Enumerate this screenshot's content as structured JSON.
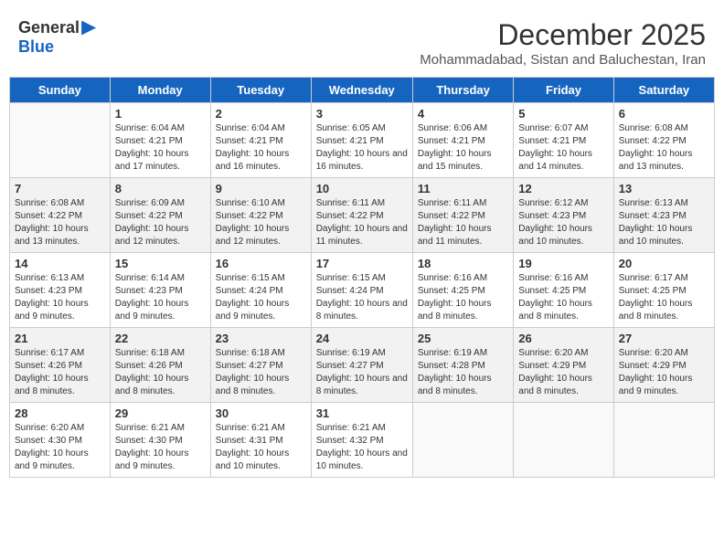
{
  "logo": {
    "general": "General",
    "blue": "Blue"
  },
  "title": "December 2025",
  "subtitle": "Mohammadabad, Sistan and Baluchestan, Iran",
  "days_of_week": [
    "Sunday",
    "Monday",
    "Tuesday",
    "Wednesday",
    "Thursday",
    "Friday",
    "Saturday"
  ],
  "weeks": [
    [
      {
        "day": "",
        "info": ""
      },
      {
        "day": "1",
        "info": "Sunrise: 6:04 AM\nSunset: 4:21 PM\nDaylight: 10 hours and 17 minutes."
      },
      {
        "day": "2",
        "info": "Sunrise: 6:04 AM\nSunset: 4:21 PM\nDaylight: 10 hours and 16 minutes."
      },
      {
        "day": "3",
        "info": "Sunrise: 6:05 AM\nSunset: 4:21 PM\nDaylight: 10 hours and 16 minutes."
      },
      {
        "day": "4",
        "info": "Sunrise: 6:06 AM\nSunset: 4:21 PM\nDaylight: 10 hours and 15 minutes."
      },
      {
        "day": "5",
        "info": "Sunrise: 6:07 AM\nSunset: 4:21 PM\nDaylight: 10 hours and 14 minutes."
      },
      {
        "day": "6",
        "info": "Sunrise: 6:08 AM\nSunset: 4:22 PM\nDaylight: 10 hours and 13 minutes."
      }
    ],
    [
      {
        "day": "7",
        "info": "Sunrise: 6:08 AM\nSunset: 4:22 PM\nDaylight: 10 hours and 13 minutes."
      },
      {
        "day": "8",
        "info": "Sunrise: 6:09 AM\nSunset: 4:22 PM\nDaylight: 10 hours and 12 minutes."
      },
      {
        "day": "9",
        "info": "Sunrise: 6:10 AM\nSunset: 4:22 PM\nDaylight: 10 hours and 12 minutes."
      },
      {
        "day": "10",
        "info": "Sunrise: 6:11 AM\nSunset: 4:22 PM\nDaylight: 10 hours and 11 minutes."
      },
      {
        "day": "11",
        "info": "Sunrise: 6:11 AM\nSunset: 4:22 PM\nDaylight: 10 hours and 11 minutes."
      },
      {
        "day": "12",
        "info": "Sunrise: 6:12 AM\nSunset: 4:23 PM\nDaylight: 10 hours and 10 minutes."
      },
      {
        "day": "13",
        "info": "Sunrise: 6:13 AM\nSunset: 4:23 PM\nDaylight: 10 hours and 10 minutes."
      }
    ],
    [
      {
        "day": "14",
        "info": "Sunrise: 6:13 AM\nSunset: 4:23 PM\nDaylight: 10 hours and 9 minutes."
      },
      {
        "day": "15",
        "info": "Sunrise: 6:14 AM\nSunset: 4:23 PM\nDaylight: 10 hours and 9 minutes."
      },
      {
        "day": "16",
        "info": "Sunrise: 6:15 AM\nSunset: 4:24 PM\nDaylight: 10 hours and 9 minutes."
      },
      {
        "day": "17",
        "info": "Sunrise: 6:15 AM\nSunset: 4:24 PM\nDaylight: 10 hours and 8 minutes."
      },
      {
        "day": "18",
        "info": "Sunrise: 6:16 AM\nSunset: 4:25 PM\nDaylight: 10 hours and 8 minutes."
      },
      {
        "day": "19",
        "info": "Sunrise: 6:16 AM\nSunset: 4:25 PM\nDaylight: 10 hours and 8 minutes."
      },
      {
        "day": "20",
        "info": "Sunrise: 6:17 AM\nSunset: 4:25 PM\nDaylight: 10 hours and 8 minutes."
      }
    ],
    [
      {
        "day": "21",
        "info": "Sunrise: 6:17 AM\nSunset: 4:26 PM\nDaylight: 10 hours and 8 minutes."
      },
      {
        "day": "22",
        "info": "Sunrise: 6:18 AM\nSunset: 4:26 PM\nDaylight: 10 hours and 8 minutes."
      },
      {
        "day": "23",
        "info": "Sunrise: 6:18 AM\nSunset: 4:27 PM\nDaylight: 10 hours and 8 minutes."
      },
      {
        "day": "24",
        "info": "Sunrise: 6:19 AM\nSunset: 4:27 PM\nDaylight: 10 hours and 8 minutes."
      },
      {
        "day": "25",
        "info": "Sunrise: 6:19 AM\nSunset: 4:28 PM\nDaylight: 10 hours and 8 minutes."
      },
      {
        "day": "26",
        "info": "Sunrise: 6:20 AM\nSunset: 4:29 PM\nDaylight: 10 hours and 8 minutes."
      },
      {
        "day": "27",
        "info": "Sunrise: 6:20 AM\nSunset: 4:29 PM\nDaylight: 10 hours and 9 minutes."
      }
    ],
    [
      {
        "day": "28",
        "info": "Sunrise: 6:20 AM\nSunset: 4:30 PM\nDaylight: 10 hours and 9 minutes."
      },
      {
        "day": "29",
        "info": "Sunrise: 6:21 AM\nSunset: 4:30 PM\nDaylight: 10 hours and 9 minutes."
      },
      {
        "day": "30",
        "info": "Sunrise: 6:21 AM\nSunset: 4:31 PM\nDaylight: 10 hours and 10 minutes."
      },
      {
        "day": "31",
        "info": "Sunrise: 6:21 AM\nSunset: 4:32 PM\nDaylight: 10 hours and 10 minutes."
      },
      {
        "day": "",
        "info": ""
      },
      {
        "day": "",
        "info": ""
      },
      {
        "day": "",
        "info": ""
      }
    ]
  ]
}
